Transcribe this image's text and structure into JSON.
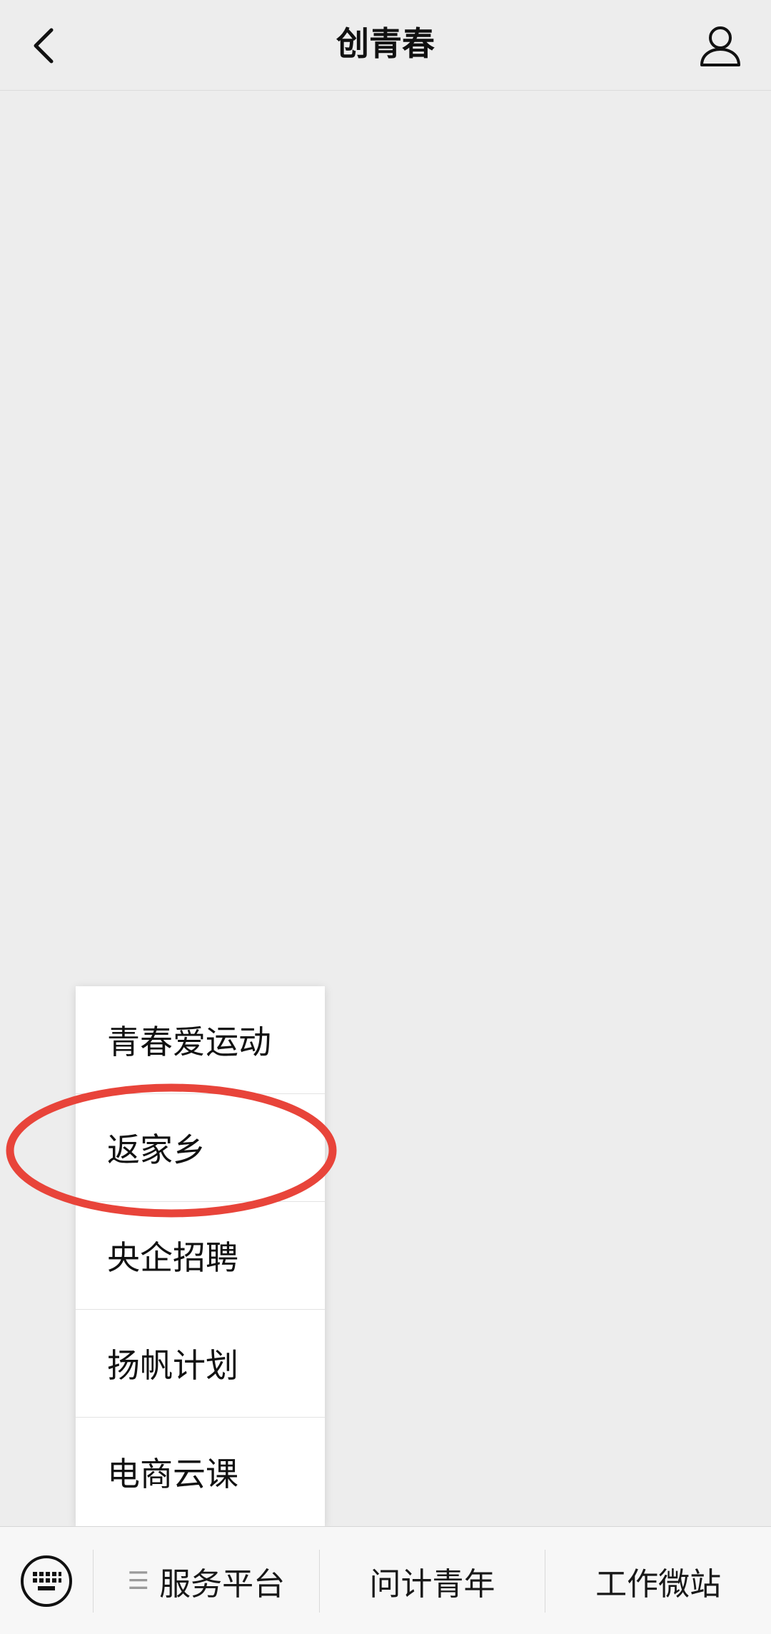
{
  "header": {
    "title": "创青春",
    "back_icon": "chevron-left-icon",
    "profile_icon": "user-icon"
  },
  "popup_menu": {
    "items": [
      {
        "label": "青春爱运动"
      },
      {
        "label": "返家乡"
      },
      {
        "label": "央企招聘"
      },
      {
        "label": "扬帆计划"
      },
      {
        "label": "电商云课"
      }
    ],
    "highlighted_item": "返家乡",
    "highlight_color": "#e8443a"
  },
  "bottom_bar": {
    "keyboard_icon": "keyboard-icon",
    "tabs": [
      {
        "label": "服务平台",
        "prefix_icon": "≡"
      },
      {
        "label": "问计青年"
      },
      {
        "label": "工作微站"
      }
    ]
  },
  "colors": {
    "background": "#ededed",
    "bottom_bar": "#f7f7f7",
    "menu_bg": "#ffffff"
  }
}
